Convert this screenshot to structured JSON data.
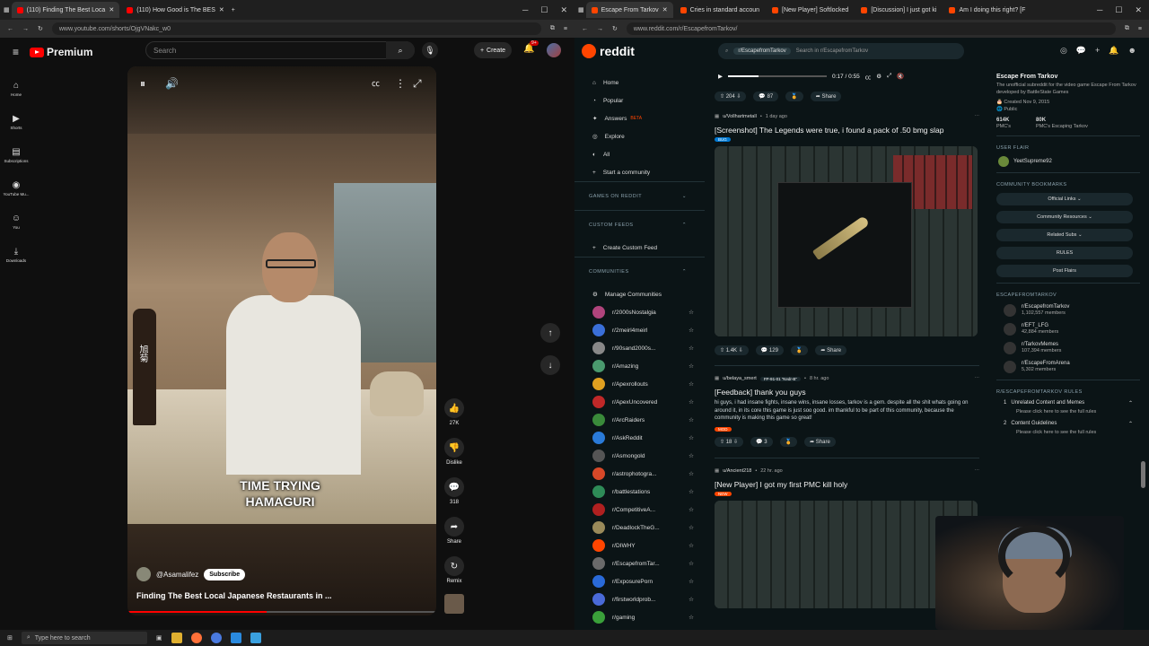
{
  "left_browser": {
    "tabs": [
      {
        "title": "(110) Finding The Best Loca",
        "color": "#ff0000",
        "active": true
      },
      {
        "title": "(110) How Good is The BES",
        "color": "#ff0000",
        "active": false
      }
    ],
    "url": "www.youtube.com/shorts/OjgVNakc_w0"
  },
  "youtube": {
    "logo": "Premium",
    "search_placeholder": "Search",
    "create_label": "Create",
    "notif_count": "9+",
    "sidebar": [
      {
        "label": "Home",
        "icon": "⌂"
      },
      {
        "label": "Shorts",
        "icon": "▶"
      },
      {
        "label": "Subscriptions",
        "icon": "▤"
      },
      {
        "label": "YouTube Mu...",
        "icon": "◉"
      },
      {
        "label": "You",
        "icon": "☺"
      },
      {
        "label": "Downloads",
        "icon": "⤓"
      }
    ],
    "video": {
      "caption_line1": "TIME TRYING",
      "caption_line2": "HAMAGURI",
      "channel": "@Asamalifez",
      "subscribe": "Subscribe",
      "title": "Finding The Best Local Japanese Restaurants in ...",
      "progress": 0.45
    },
    "rail": {
      "likes": "27K",
      "dislike": "Dislike",
      "comments": "318",
      "share": "Share",
      "remix": "Remix"
    }
  },
  "right_browser": {
    "tabs": [
      {
        "title": "Escape From Tarkov",
        "color": "#ff4500",
        "active": true
      },
      {
        "title": "Cries in standard accoun",
        "color": "#ff4500",
        "active": false
      },
      {
        "title": "[New Player] Softlocked",
        "color": "#ff4500",
        "active": false
      },
      {
        "title": "[Discussion] I just got ki",
        "color": "#ff4500",
        "active": false
      },
      {
        "title": "Am I doing this right? [F",
        "color": "#ff4500",
        "active": false
      }
    ],
    "url": "www.reddit.com/r/EscapefromTarkov/"
  },
  "reddit": {
    "logo": "reddit",
    "search_chip": "r/EscapefromTarkov",
    "search_placeholder": "Search in r/EscapefromTarkov",
    "nav": [
      {
        "label": "Home",
        "icon": "⌂"
      },
      {
        "label": "Popular",
        "icon": "◔"
      },
      {
        "label": "Answers",
        "icon": "✦",
        "badge": "BETA"
      },
      {
        "label": "Explore",
        "icon": "◎"
      },
      {
        "label": "All",
        "icon": "◐"
      },
      {
        "label": "Start a community",
        "icon": "+"
      }
    ],
    "sections": {
      "games": "GAMES ON REDDIT",
      "custom_feeds": "CUSTOM FEEDS",
      "create_custom_feed": "Create Custom Feed",
      "communities": "COMMUNITIES",
      "manage": "Manage Communities"
    },
    "communities": [
      {
        "name": "r/2000sNostalgia",
        "color": "#b0447c"
      },
      {
        "name": "r/2meirl4meirl",
        "color": "#3a6fd8"
      },
      {
        "name": "r/90sand2000s...",
        "color": "#888888"
      },
      {
        "name": "r/Amazing",
        "color": "#4a9a6e"
      },
      {
        "name": "r/Apexrollouts",
        "color": "#e0a020"
      },
      {
        "name": "r/ApexUncovered",
        "color": "#c02828"
      },
      {
        "name": "r/ArcRaiders",
        "color": "#3a8a3a"
      },
      {
        "name": "r/AskReddit",
        "color": "#2a7ad8"
      },
      {
        "name": "r/Asmongold",
        "color": "#555555"
      },
      {
        "name": "r/astrophotogra...",
        "color": "#d84828"
      },
      {
        "name": "r/battlestations",
        "color": "#2e8b57"
      },
      {
        "name": "r/CompetitiveA...",
        "color": "#b02020"
      },
      {
        "name": "r/DeadlockTheG...",
        "color": "#9a8a5a"
      },
      {
        "name": "r/DIWHY",
        "color": "#ff4500"
      },
      {
        "name": "r/EscapefromTar...",
        "color": "#6a6a6a"
      },
      {
        "name": "r/ExposurePorn",
        "color": "#2a6ad8"
      },
      {
        "name": "r/firstworldprob...",
        "color": "#4a6ad8"
      },
      {
        "name": "r/gaming",
        "color": "#3aa03a"
      }
    ],
    "video_player": {
      "time": "0:17 / 0:55",
      "progress": 0.31
    },
    "top_actions": {
      "votes": "204",
      "comments": "87",
      "share": "Share"
    },
    "posts": [
      {
        "author": "u/Vollhartmetall",
        "age": "1 day ago",
        "title": "[Screenshot] The Legends were true, i found a pack of .50 bmg slap",
        "flair": "BUG",
        "votes": "1.4K",
        "comments": "129",
        "share": "Share"
      },
      {
        "author": "u/belaya_smert",
        "author_flair": "FP-91-01 \"Kedr-B\"",
        "age": "8 hr. ago",
        "title": "[Feedback] thank you guys",
        "body": "hi guys, i had insane fights, insane wins, insane losses, tarkov is a gem. despite all the shit whats going on around it, in its core this game is just soo good. im thankful to be part of this community, because the community is making this game so great!",
        "flair": "MOD",
        "votes": "18",
        "comments": "3",
        "share": "Share"
      },
      {
        "author": "u/Ancient218",
        "age": "22 hr. ago",
        "title": "[New Player] I got my first PMC kill holy",
        "flair": "NEW"
      }
    ],
    "sidebar": {
      "title": "Escape From Tarkov",
      "desc": "The unofficial subreddit for the video game Escape From Tarkov developed by BattleState Games",
      "created": "Created Nov 9, 2015",
      "visibility": "Public",
      "members": "614K",
      "members_label": "PMC's",
      "online": "80K",
      "online_label": "PMC's Escaping Tarkov",
      "user_flair_label": "USER FLAIR",
      "user_flair_name": "YeetSupreme92",
      "bookmarks_label": "COMMUNITY BOOKMARKS",
      "bookmarks": [
        "Official Links",
        "Community Resources",
        "Related Subs",
        "RULES",
        "Post Flairs"
      ],
      "related_label": "ESCAPEFROMTARKOV",
      "related": [
        {
          "name": "r/EscapefromTarkov",
          "members": "1,102,557 members"
        },
        {
          "name": "r/EFT_LFG",
          "members": "42,884 members"
        },
        {
          "name": "r/TarkovMemes",
          "members": "107,394 members"
        },
        {
          "name": "r/EscapeFromArena",
          "members": "5,302 members"
        }
      ],
      "rules_label": "R/ESCAPEFROMTARKOV RULES",
      "rules": [
        {
          "num": "1",
          "title": "Unrelated Content and Memes",
          "note": "Please click here to see the full rules"
        },
        {
          "num": "2",
          "title": "Content Guidelines",
          "note": "Please click here to see the full rules"
        }
      ]
    }
  },
  "taskbar": {
    "search_placeholder": "Type here to search"
  }
}
